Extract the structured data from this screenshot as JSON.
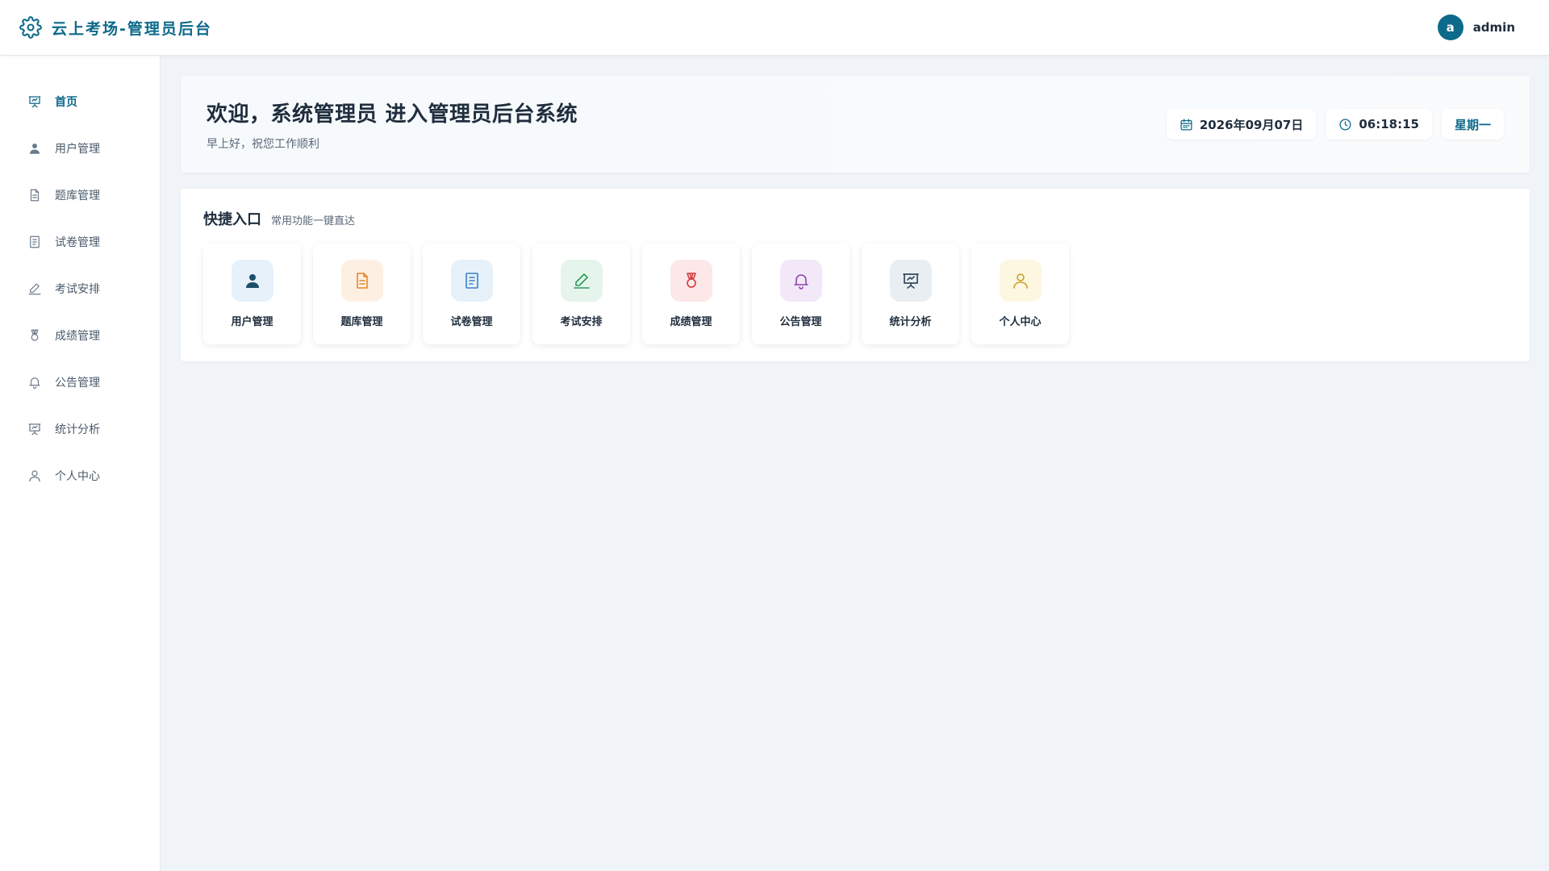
{
  "header": {
    "title": "云上考场-管理员后台",
    "user": {
      "avatar_letter": "a",
      "name": "admin"
    }
  },
  "sidebar": {
    "items": [
      {
        "label": "首页",
        "icon": "presentation-chart-icon",
        "active": true
      },
      {
        "label": "用户管理",
        "icon": "user-solid-icon"
      },
      {
        "label": "题库管理",
        "icon": "document-icon"
      },
      {
        "label": "试卷管理",
        "icon": "document-list-icon"
      },
      {
        "label": "考试安排",
        "icon": "edit-pen-icon"
      },
      {
        "label": "成绩管理",
        "icon": "medal-icon"
      },
      {
        "label": "公告管理",
        "icon": "bell-icon"
      },
      {
        "label": "统计分析",
        "icon": "presentation-chart-icon"
      },
      {
        "label": "个人中心",
        "icon": "user-outline-icon"
      }
    ]
  },
  "welcome": {
    "title": "欢迎，系统管理员 进入管理员后台系统",
    "subtitle": "早上好，祝您工作顺利",
    "date": "2026年09月07日",
    "time": "06:18:15",
    "weekday": "星期一"
  },
  "quick": {
    "title": "快捷入口",
    "subtitle": "常用功能一键直达",
    "cards": [
      {
        "label": "用户管理",
        "icon": "user-solid-icon",
        "color": "#1d4e6b",
        "bg": "#e6f1fa"
      },
      {
        "label": "题库管理",
        "icon": "document-icon",
        "color": "#e8862a",
        "bg": "#fdf0e3"
      },
      {
        "label": "试卷管理",
        "icon": "document-list-icon",
        "color": "#3b82c4",
        "bg": "#e6f1fa"
      },
      {
        "label": "考试安排",
        "icon": "edit-pen-icon",
        "color": "#2e9a5c",
        "bg": "#e5f5ec"
      },
      {
        "label": "成绩管理",
        "icon": "medal-icon",
        "color": "#d23b3b",
        "bg": "#fce8e8"
      },
      {
        "label": "公告管理",
        "icon": "bell-icon",
        "color": "#8e44ad",
        "bg": "#f3e8f7"
      },
      {
        "label": "统计分析",
        "icon": "presentation-chart-icon",
        "color": "#34495e",
        "bg": "#e9eef3"
      },
      {
        "label": "个人中心",
        "icon": "user-outline-icon",
        "color": "#c9a227",
        "bg": "#fdf6e1"
      }
    ]
  }
}
